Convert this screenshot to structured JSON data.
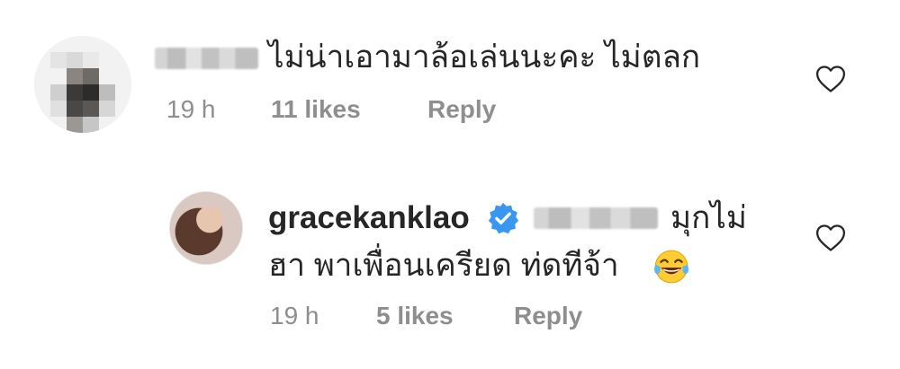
{
  "comments": [
    {
      "username_blurred": true,
      "text": "ไม่น่าเอามาล้อเล่นนะคะ ไม่ตลก",
      "time": "19 h",
      "likes": "11 likes",
      "reply_label": "Reply",
      "like_icon": "heart-outline-icon"
    },
    {
      "username": "gracekanklao",
      "verified": true,
      "mention_blurred": true,
      "text_line1": "มุกไม่",
      "text_line2": "ฮา พาเพื่อนเครียด ท่ดทีจ้า",
      "emoji": "face-with-tears-of-joy",
      "time": "19 h",
      "likes": "5 likes",
      "reply_label": "Reply",
      "like_icon": "heart-outline-icon"
    }
  ],
  "colors": {
    "text": "#262626",
    "meta": "#8e8e8e",
    "verified": "#3897f0",
    "background": "#ffffff"
  }
}
